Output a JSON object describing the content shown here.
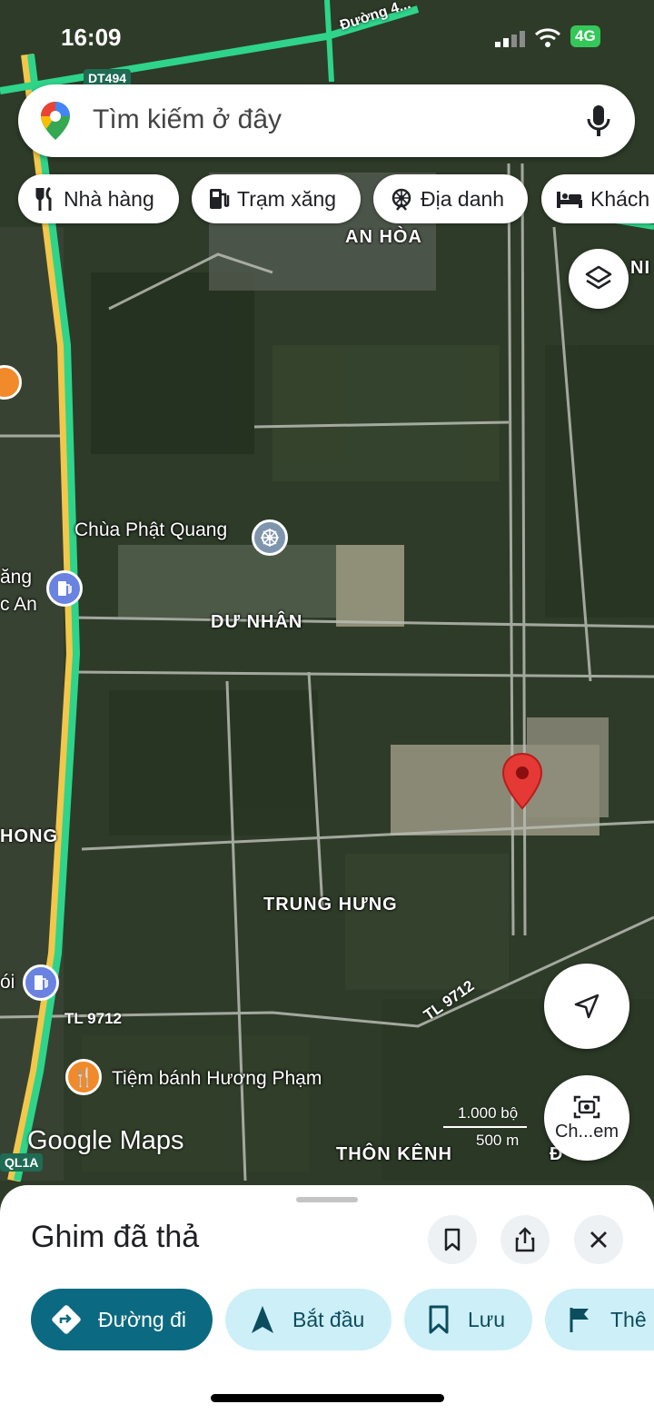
{
  "status_bar": {
    "time": "16:09",
    "network": "4G"
  },
  "search": {
    "placeholder": "Tìm kiếm ở đây"
  },
  "chips": [
    {
      "label": "Nhà hàng",
      "icon": "fork-knife-icon"
    },
    {
      "label": "Trạm xăng",
      "icon": "gas-station-icon"
    },
    {
      "label": "Địa danh",
      "icon": "landmark-icon"
    },
    {
      "label": "Khách",
      "icon": "bed-icon"
    }
  ],
  "map": {
    "places": [
      "AN HÒA",
      "DƯ NHÂN",
      "TRUNG HƯNG",
      "THÔN KÊNH",
      "HONG",
      "NI",
      "ăng",
      "c An",
      "ói"
    ],
    "road_badges": [
      "DT494",
      "TL 9712",
      "TL 9712",
      "QL1A",
      "Đường 4..."
    ],
    "pois": [
      "Chùa Phật Quang",
      "Tiệm bánh Hương Phạm"
    ],
    "watermark": "Google Maps",
    "scale": {
      "feet": "1.000 bộ",
      "meters": "500 m"
    },
    "partial_label": "Đ",
    "camera_fab_label": "Ch...em"
  },
  "sheet": {
    "title": "Ghim đã thả",
    "actions": [
      {
        "label": "Đường đi",
        "icon": "directions-icon"
      },
      {
        "label": "Bắt đầu",
        "icon": "navigation-arrow-icon"
      },
      {
        "label": "Lưu",
        "icon": "bookmark-icon"
      },
      {
        "label": "Thê",
        "icon": "flag-icon"
      }
    ]
  },
  "colors": {
    "primary": "#0b6a81",
    "secondary": "#cdeff7",
    "pin": "#e53935",
    "road": "#34c759"
  }
}
